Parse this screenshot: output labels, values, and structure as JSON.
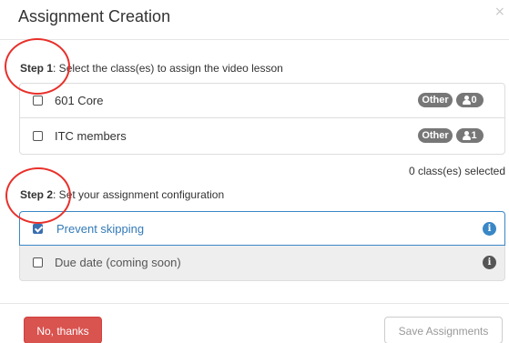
{
  "dialog": {
    "title": "Assignment Creation",
    "close_glyph": "×"
  },
  "step1": {
    "prefix": "Step 1",
    "text": ": Select the class(es) to assign the video lesson",
    "classes": [
      {
        "name": "601 Core",
        "tag": "Other",
        "count": "0",
        "checked": false
      },
      {
        "name": "ITC members",
        "tag": "Other",
        "count": "1",
        "checked": false
      }
    ],
    "selected_summary": "0 class(es) selected"
  },
  "step2": {
    "prefix": "Step 2",
    "text": ": Set your assignment configuration",
    "options": [
      {
        "label": "Prevent skipping",
        "checked": true,
        "icon": "info-icon"
      },
      {
        "label": "Due date (coming soon)",
        "checked": false,
        "icon": "info-icon"
      }
    ]
  },
  "footer": {
    "cancel_label": "No, thanks",
    "save_label": "Save Assignments"
  },
  "colors": {
    "primary": "#3a87c6",
    "danger": "#d9534f",
    "badge": "#777777",
    "annotation": "#e8302a"
  }
}
